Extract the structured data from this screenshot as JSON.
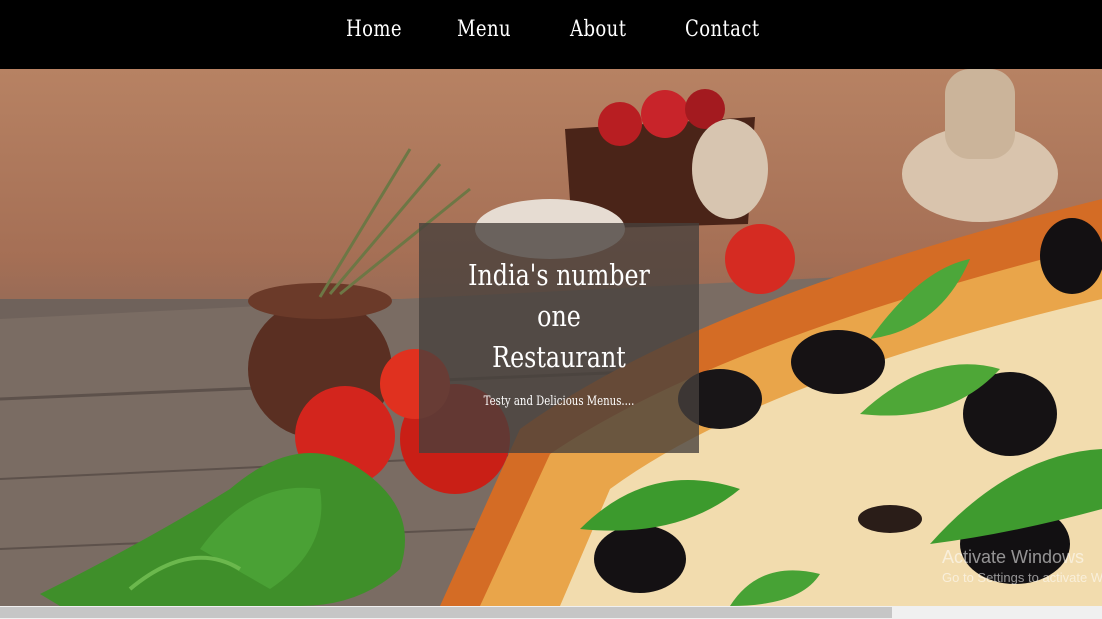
{
  "nav": {
    "items": [
      {
        "label": "Home"
      },
      {
        "label": "Menu"
      },
      {
        "label": "About"
      },
      {
        "label": "Contact"
      }
    ]
  },
  "hero": {
    "title_line1": "India's number one",
    "title_line2": "Restaurant",
    "subtitle": "Testy and Delicious Menus...."
  },
  "watermark": {
    "title": "Activate Windows",
    "subtitle": "Go to Settings to activate Windows."
  }
}
